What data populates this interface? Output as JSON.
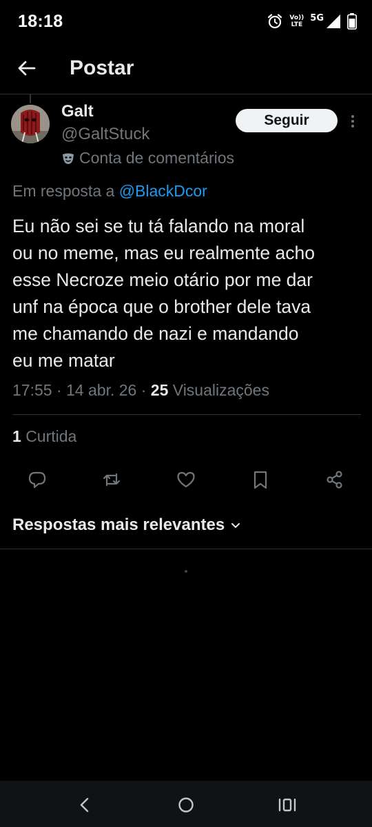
{
  "status_bar": {
    "time": "18:18",
    "volte_top": "Vo))",
    "volte_bottom": "LTE",
    "network": "5G",
    "icons": [
      "alarm-icon",
      "volte-icon",
      "signal-icon",
      "battery-icon"
    ]
  },
  "header": {
    "title": "Postar",
    "back_icon": "arrow-left-icon"
  },
  "author": {
    "name": "Galt",
    "handle": "@GaltStuck",
    "account_label": "Conta de comentários",
    "account_icon": "theater-mask-icon",
    "follow_label": "Seguir",
    "more_icon": "more-vertical-icon"
  },
  "post": {
    "reply_prefix": "Em resposta a",
    "reply_to": "@BlackDcor",
    "text_lines": [
      "Eu não sei se tu tá falando na moral",
      "ou no meme, mas eu realmente acho",
      "esse Necroze meio otário por me dar",
      "unf na época que o brother dele tava",
      "me chamando de nazi e mandando",
      "eu me matar"
    ],
    "time": "17:55",
    "date": "14 abr. 26",
    "separator": "·",
    "views_count": "25",
    "views_label": "Visualizações",
    "likes_count": "1",
    "likes_label": "Curtida"
  },
  "actions": [
    {
      "name": "reply",
      "icon": "reply-icon"
    },
    {
      "name": "repost",
      "icon": "repost-icon"
    },
    {
      "name": "like",
      "icon": "heart-icon"
    },
    {
      "name": "bookmark",
      "icon": "bookmark-icon"
    },
    {
      "name": "share",
      "icon": "share-icon"
    }
  ],
  "replies": {
    "sort_label": "Respostas mais relevantes",
    "sort_icon": "chevron-down-icon"
  },
  "nav_bar": {
    "buttons": [
      "back-icon",
      "home-icon",
      "recents-icon"
    ]
  },
  "colors": {
    "background": "#000000",
    "text_primary": "#e7e9ea",
    "text_secondary": "#71767b",
    "accent": "#1d9bf0",
    "divider": "#2f3336",
    "follow_bg": "#eff3f4"
  }
}
